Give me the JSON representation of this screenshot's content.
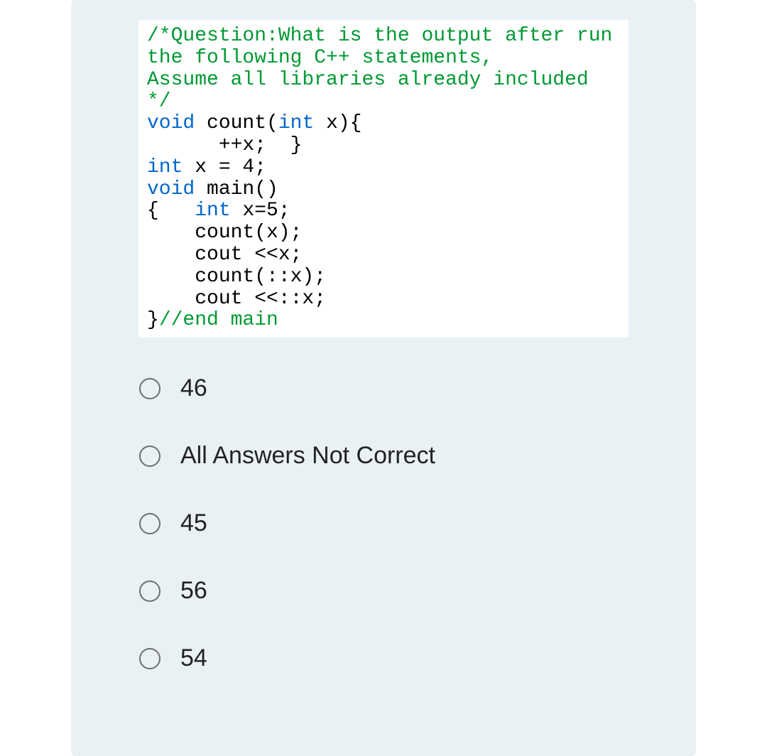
{
  "code": {
    "l1": "/*Question:What is the output after run",
    "l2": "the following C++ statements,",
    "l3": "Assume all libraries already included",
    "l4": "*/",
    "l5a": "void",
    "l5b": " count(",
    "l5c": "int",
    "l5d": " x){",
    "l6": "      ++x;  }",
    "l7a": "int",
    "l7b": " x = 4;",
    "l8a": "void",
    "l8b": " main()",
    "l9a": "{   ",
    "l9b": "int",
    "l9c": " x=5;",
    "l10": "    count(x);",
    "l11": "    cout <<x;",
    "l12": "    count(::x);",
    "l13": "    cout <<::x;",
    "l14a": "}",
    "l14b": "//end main"
  },
  "options": [
    {
      "label": "46"
    },
    {
      "label": "All Answers Not Correct"
    },
    {
      "label": "45"
    },
    {
      "label": "56"
    },
    {
      "label": "54"
    }
  ]
}
